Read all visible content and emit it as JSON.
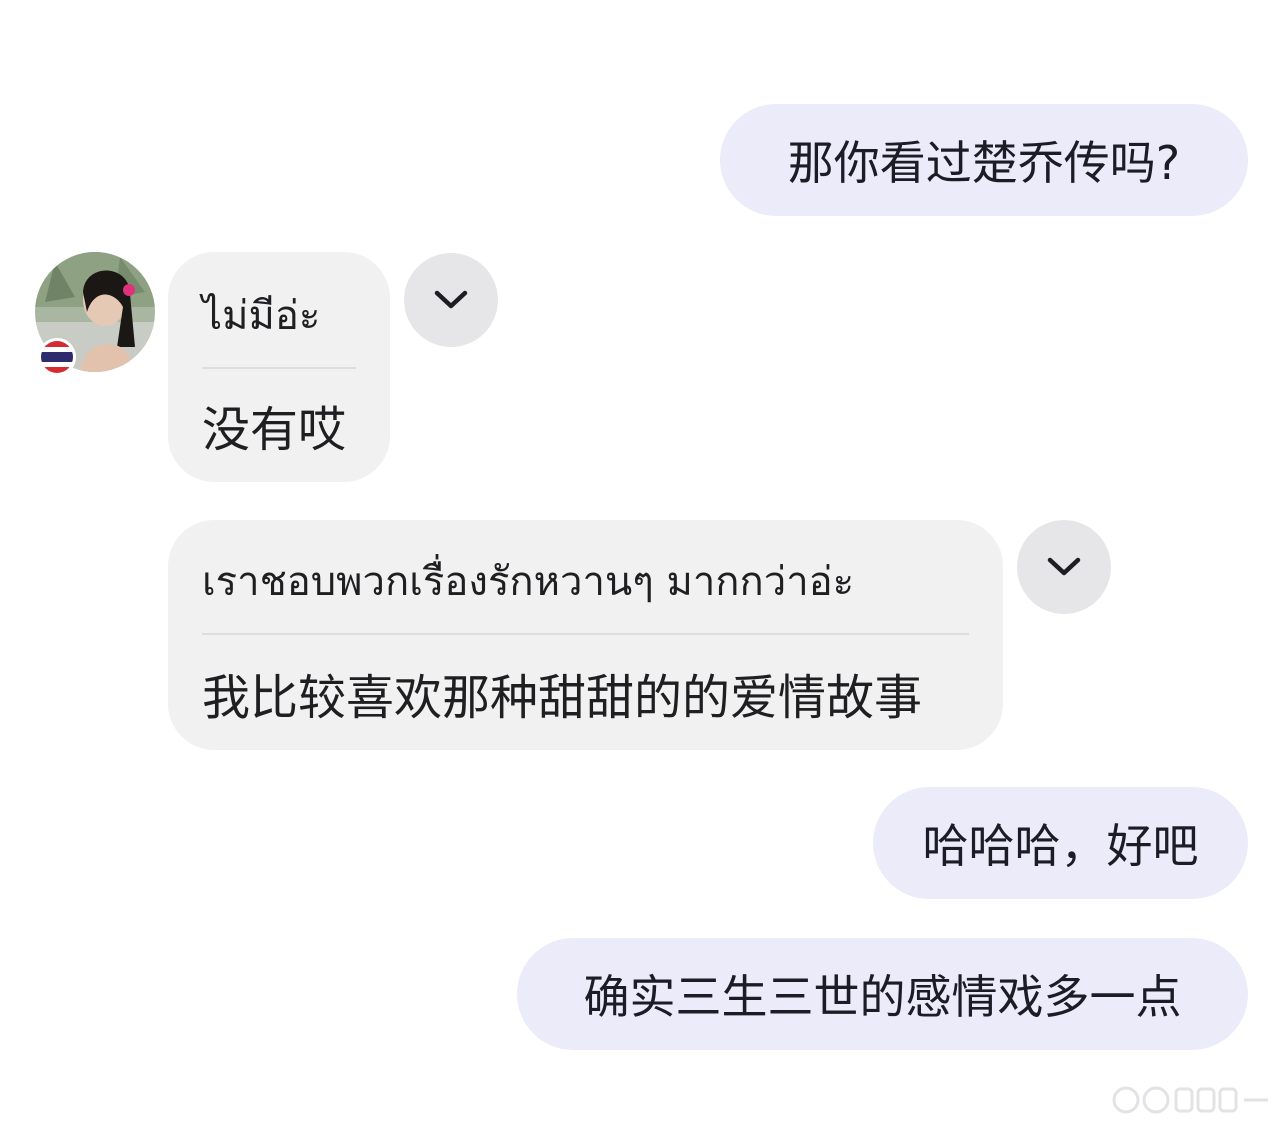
{
  "messages": [
    {
      "id": "m1",
      "side": "outgoing",
      "text": "那你看过楚乔传吗?"
    },
    {
      "id": "m2",
      "side": "incoming",
      "original": "ไม่มีอ่ะ",
      "translation": "没有哎"
    },
    {
      "id": "m3",
      "side": "incoming",
      "original": "เราชอบพวกเรื่องรักหวานๆ มากกว่าอ่ะ",
      "translation": "我比较喜欢那种甜甜的的爱情故事"
    },
    {
      "id": "m4",
      "side": "outgoing",
      "text": "哈哈哈，好吧"
    },
    {
      "id": "m5",
      "side": "outgoing",
      "text": "确实三生三世的感情戏多一点"
    }
  ],
  "contact": {
    "avatar_icon": "contact-photo",
    "flag_icon": "thailand-flag-icon"
  },
  "icons": {
    "expand": "chevron-down-icon"
  },
  "colors": {
    "outgoing_bubble": "#ecebfa",
    "incoming_bubble": "#f1f1f2",
    "expand_button": "#e6e6e8"
  }
}
